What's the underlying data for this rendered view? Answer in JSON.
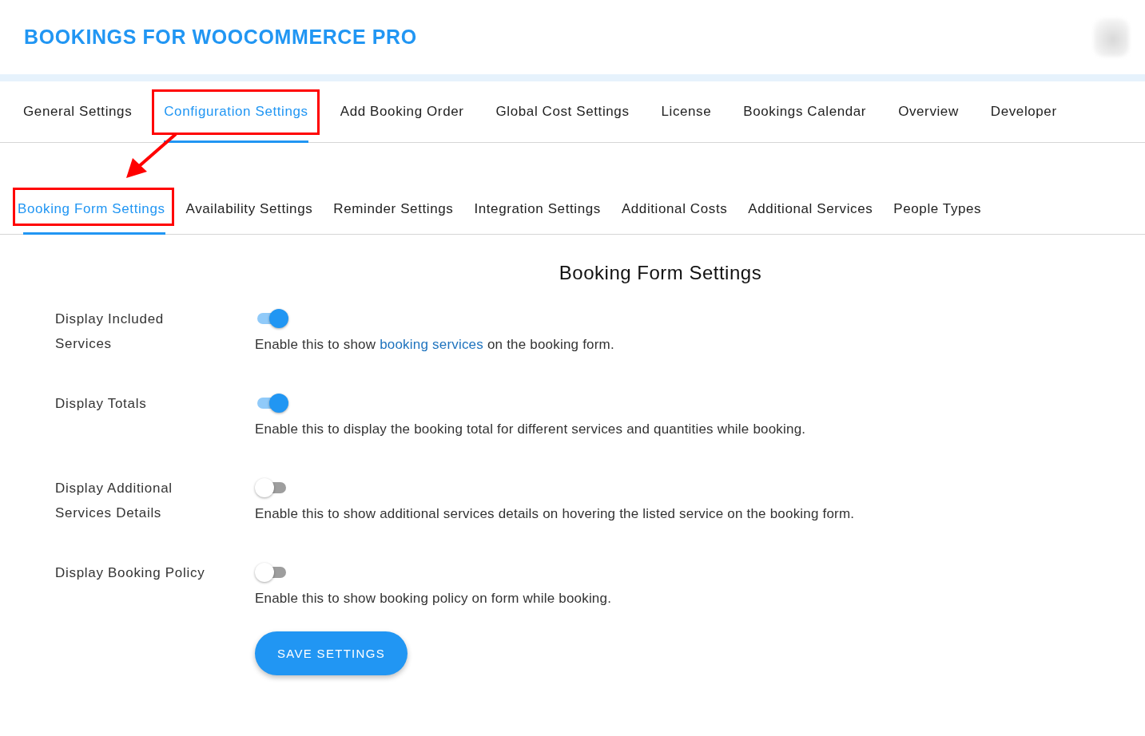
{
  "header": {
    "title": "BOOKINGS FOR WOOCOMMERCE PRO"
  },
  "tabs": [
    {
      "label": "General Settings",
      "selected": false,
      "highlighted": false
    },
    {
      "label": "Configuration Settings",
      "selected": true,
      "highlighted": true
    },
    {
      "label": "Add Booking Order",
      "selected": false,
      "highlighted": false
    },
    {
      "label": "Global Cost Settings",
      "selected": false,
      "highlighted": false
    },
    {
      "label": "License",
      "selected": false,
      "highlighted": false
    },
    {
      "label": "Bookings Calendar",
      "selected": false,
      "highlighted": false
    },
    {
      "label": "Overview",
      "selected": false,
      "highlighted": false
    },
    {
      "label": "Developer",
      "selected": false,
      "highlighted": false
    }
  ],
  "subtabs": [
    {
      "label": "Booking Form Settings",
      "selected": true,
      "highlighted": true
    },
    {
      "label": "Availability Settings",
      "selected": false,
      "highlighted": false
    },
    {
      "label": "Reminder Settings",
      "selected": false,
      "highlighted": false
    },
    {
      "label": "Integration Settings",
      "selected": false,
      "highlighted": false
    },
    {
      "label": "Additional Costs",
      "selected": false,
      "highlighted": false
    },
    {
      "label": "Additional Services",
      "selected": false,
      "highlighted": false
    },
    {
      "label": "People Types",
      "selected": false,
      "highlighted": false
    }
  ],
  "section_title": "Booking Form Settings",
  "settings": [
    {
      "label": "Display Included Services",
      "on": true,
      "description": [
        {
          "kind": "text",
          "text": "Enable this to show "
        },
        {
          "kind": "link",
          "text": "booking services"
        },
        {
          "kind": "text",
          "text": " on the booking form."
        }
      ]
    },
    {
      "label": "Display Totals",
      "on": true,
      "description": [
        {
          "kind": "text",
          "text": "Enable this to display the booking total for different services and quantities while booking."
        }
      ]
    },
    {
      "label": "Display Additional Services Details",
      "on": false,
      "description": [
        {
          "kind": "text",
          "text": "Enable this to show additional services details on hovering the listed service on the booking form."
        }
      ]
    },
    {
      "label": "Display Booking Policy",
      "on": false,
      "description": [
        {
          "kind": "text",
          "text": "Enable this to show booking policy on form while booking."
        }
      ]
    }
  ],
  "save_button": "SAVE SETTINGS"
}
